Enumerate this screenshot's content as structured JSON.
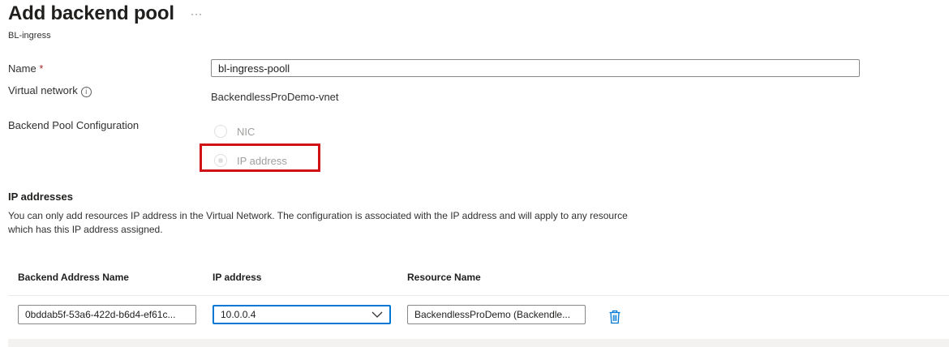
{
  "header": {
    "title": "Add backend pool",
    "more_label": "···",
    "subtitle": "BL-ingress"
  },
  "form": {
    "name_label": "Name",
    "required_mark": "*",
    "name_value": "bl-ingress-pooll",
    "vnet_label": "Virtual network",
    "info_glyph": "i",
    "vnet_value": "BackendlessProDemo-vnet",
    "pool_config_label": "Backend Pool Configuration",
    "options": [
      {
        "label": "NIC",
        "selected": false
      },
      {
        "label": "IP address",
        "selected": true
      }
    ]
  },
  "ip_section": {
    "title": "IP addresses",
    "description": "You can only add resources IP address in the Virtual Network. The configuration is associated with the IP address and will apply to any resource which has this IP address assigned."
  },
  "table": {
    "headers": [
      "Backend Address Name",
      "IP address",
      "Resource Name"
    ],
    "rows": [
      {
        "backend_address_name": "0bddab5f-53a6-422d-b6d4-ef61c...",
        "ip_address": "10.0.0.4",
        "resource_name": "BackendlessProDemo (Backendle..."
      }
    ]
  },
  "icons": {
    "delete": "trash-icon",
    "dropdown": "chevron-down-icon",
    "info": "info-icon"
  },
  "colors": {
    "accent": "#0078d4",
    "highlight": "#d01116",
    "required": "#a4262c"
  }
}
